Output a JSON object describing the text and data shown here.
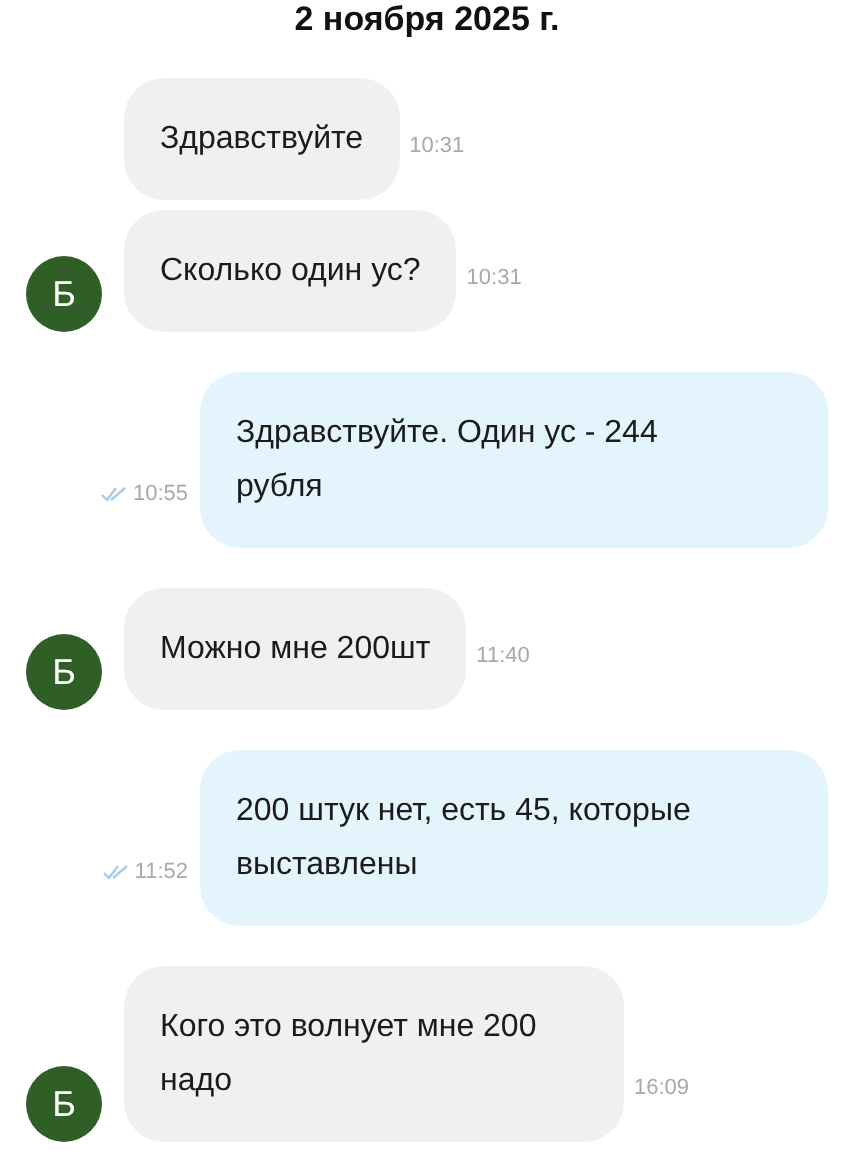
{
  "date": "2 ноября 2025 г.",
  "messages": [
    {
      "kind": "incoming",
      "text": "Здравствуйте",
      "time": "10:31"
    },
    {
      "kind": "incoming",
      "text": "Сколько один ус?",
      "time": "10:31",
      "avatar": "Б"
    },
    {
      "kind": "outgoing",
      "text": "Здравствуйте. Один ус - 244 рубля",
      "time": "10:55",
      "read": true
    },
    {
      "kind": "incoming",
      "text": "Можно мне 200шт",
      "time": "11:40",
      "avatar": "Б"
    },
    {
      "kind": "outgoing",
      "text": "200 штук нет, есть 45, которые выставлены",
      "time": "11:52",
      "read": true
    },
    {
      "kind": "incoming",
      "text": "Кого это волнует мне 200 надо",
      "time": "16:09",
      "avatar": "Б"
    }
  ]
}
